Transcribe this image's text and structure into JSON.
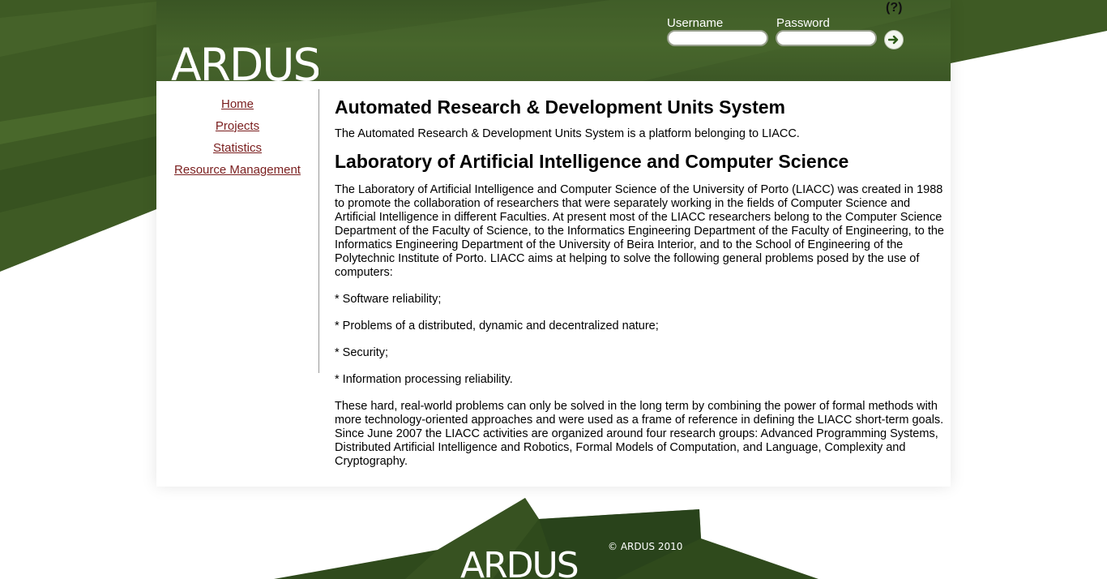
{
  "header": {
    "logo": "ARDUS",
    "help": "(?)",
    "login": {
      "username_label": "Username",
      "password_label": "Password",
      "username_value": "",
      "password_value": "",
      "submit_icon": "arrow-right-icon"
    }
  },
  "nav": {
    "items": [
      {
        "label": "Home"
      },
      {
        "label": "Projects"
      },
      {
        "label": "Statistics"
      },
      {
        "label": "Resource Management"
      }
    ]
  },
  "content": {
    "title": "Automated Research & Development Units System",
    "intro": "The Automated Research & Development Units System is a platform belonging to LIACC.",
    "lab_heading": "Laboratory of Artificial Intelligence and Computer Science",
    "lab_description": "The Laboratory of Artificial Intelligence and Computer Science of the University of Porto (LIACC) was created in 1988 to promote the collaboration of researchers that were separately working in the fields of Computer Science and Artificial Intelligence in different Faculties. At present most of the LIACC researchers belong to the Computer Science Department of the Faculty of Science, to the Informatics Engineering Department of the Faculty of Engineering, to the Informatics Engineering Department of the University of Beira Interior, and to the School of Engineering of the Polytechnic Institute of Porto. LIACC aims at helping to solve the following general problems posed by the use of computers:",
    "bullets": [
      "* Software reliability;",
      "* Problems of a distributed, dynamic and decentralized nature;",
      "* Security;",
      "* Information processing reliability."
    ],
    "closing": "These hard, real-world problems can only be solved in the long term by combining the power of formal methods with more technology-oriented approaches and were used as a frame of reference in defining the LIACC short-term goals. Since June 2007 the LIACC activities are organized around four research groups: Advanced Programming Systems, Distributed Artificial Intelligence and Robotics, Formal Models of Computation, and Language, Complexity and Cryptography."
  },
  "footer": {
    "copyright": "© ARDUS 2010",
    "logo": "ARDUS"
  },
  "colors": {
    "header_green": "#45632a",
    "dark_green": "#2f4a1c",
    "link_red": "#7a1e1e"
  }
}
